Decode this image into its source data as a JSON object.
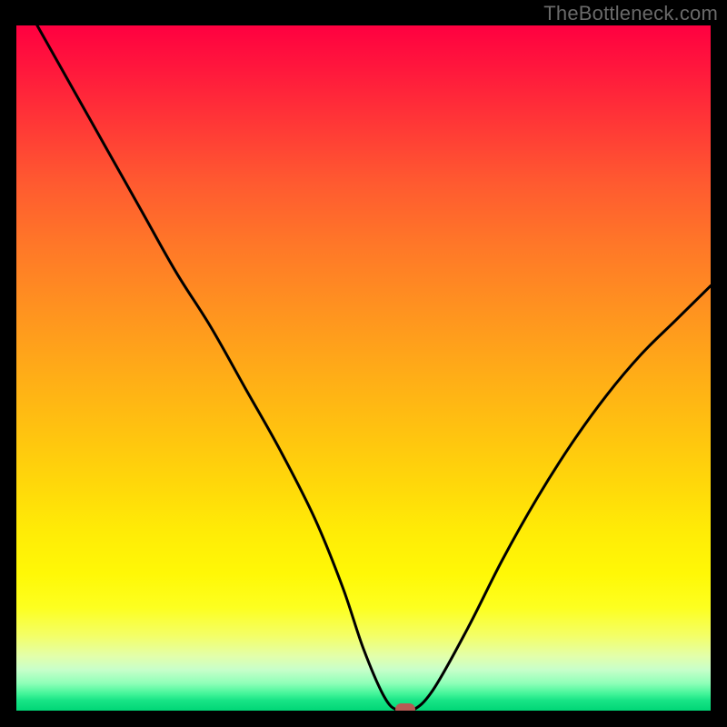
{
  "watermark": "TheBottleneck.com",
  "chart_data": {
    "type": "line",
    "title": "",
    "xlabel": "",
    "ylabel": "",
    "xlim": [
      0,
      100
    ],
    "ylim": [
      0,
      100
    ],
    "grid": false,
    "legend": false,
    "gradient_stops": [
      {
        "pct": 0,
        "color": "#ff0040"
      },
      {
        "pct": 50,
        "color": "#ffaa18"
      },
      {
        "pct": 85,
        "color": "#fdff20"
      },
      {
        "pct": 100,
        "color": "#00d676"
      }
    ],
    "series": [
      {
        "name": "bottleneck-curve",
        "color": "#000000",
        "x": [
          3,
          8,
          13,
          18,
          23,
          28,
          33,
          38,
          43,
          47,
          50,
          53,
          55,
          57,
          60,
          65,
          70,
          75,
          80,
          85,
          90,
          95,
          100
        ],
        "y": [
          100,
          91,
          82,
          73,
          64,
          56,
          47,
          38,
          28,
          18,
          9,
          2,
          0,
          0,
          3,
          12,
          22,
          31,
          39,
          46,
          52,
          57,
          62
        ]
      }
    ],
    "marker": {
      "x": 56,
      "y": 0,
      "color": "#b65a54"
    }
  }
}
